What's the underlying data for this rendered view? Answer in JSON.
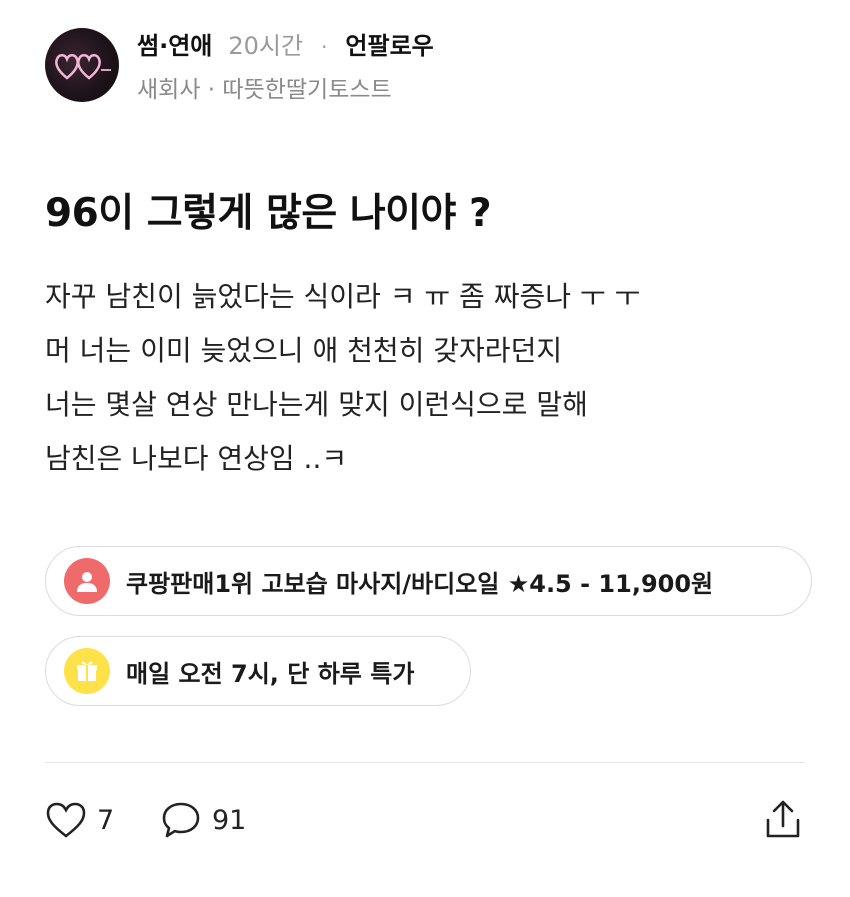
{
  "header": {
    "board": "썸·연애",
    "time": "20시간",
    "separator": "·",
    "unfollow": "언팔로우",
    "subtitle": "새회사 · 따뜻한딸기토스트"
  },
  "post": {
    "title": "96이 그렇게 많은 나이야 ?",
    "body_lines": [
      "자꾸 남친이 늙었다는 식이라 ㅋ ㅠ 좀 짜증나 ㅜ ㅜ",
      "머 너는 이미 늦었으니 애 천천히 갖자라던지",
      "너는 몇살 연상 만나는게 맞지 이런식으로 말해",
      "남친은 나보다 연상임 ..ㅋ"
    ]
  },
  "ads": [
    {
      "label": "쿠팡판매1위 고보습 마사지/바디오일 ★4.5 - 11,900원",
      "icon": "person-icon",
      "color": "#ef6a6a"
    },
    {
      "label": "매일 오전 7시, 단 하루 특가",
      "icon": "gift-icon",
      "color": "#ffe14a"
    }
  ],
  "actions": {
    "likes": "7",
    "comments": "91",
    "like_icon": "heart-icon",
    "comment_icon": "comment-icon",
    "share_icon": "share-icon"
  }
}
